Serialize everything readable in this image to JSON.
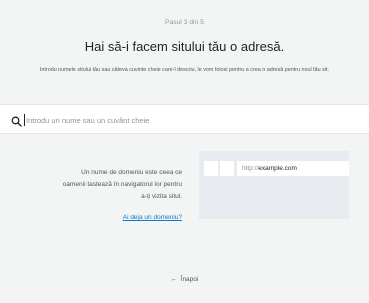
{
  "header": {
    "step": "Pasul 3 din 5",
    "title": "Hai să-i facem sitului tău o adresă.",
    "subtitle": "Introdu numele sitului tău sau câteva cuvinte cheie care-l descriu, le vom folosi pentru a crea o adresă pentru noul tău sit."
  },
  "search": {
    "placeholder": "Introdu un nume sau un cuvânt cheie",
    "value": "",
    "icon": "search-icon"
  },
  "info": {
    "description": "Un nume de domeniu este ceea ce oamenii tastează în navigatorul lor pentru a-ți vizita situl.",
    "link_label": "Ai deja un domeniu?"
  },
  "browser_mock": {
    "url_protocol": "http://",
    "url_domain": "example.com"
  },
  "footer": {
    "back_arrow": "←",
    "back_label": "Înapoi"
  }
}
